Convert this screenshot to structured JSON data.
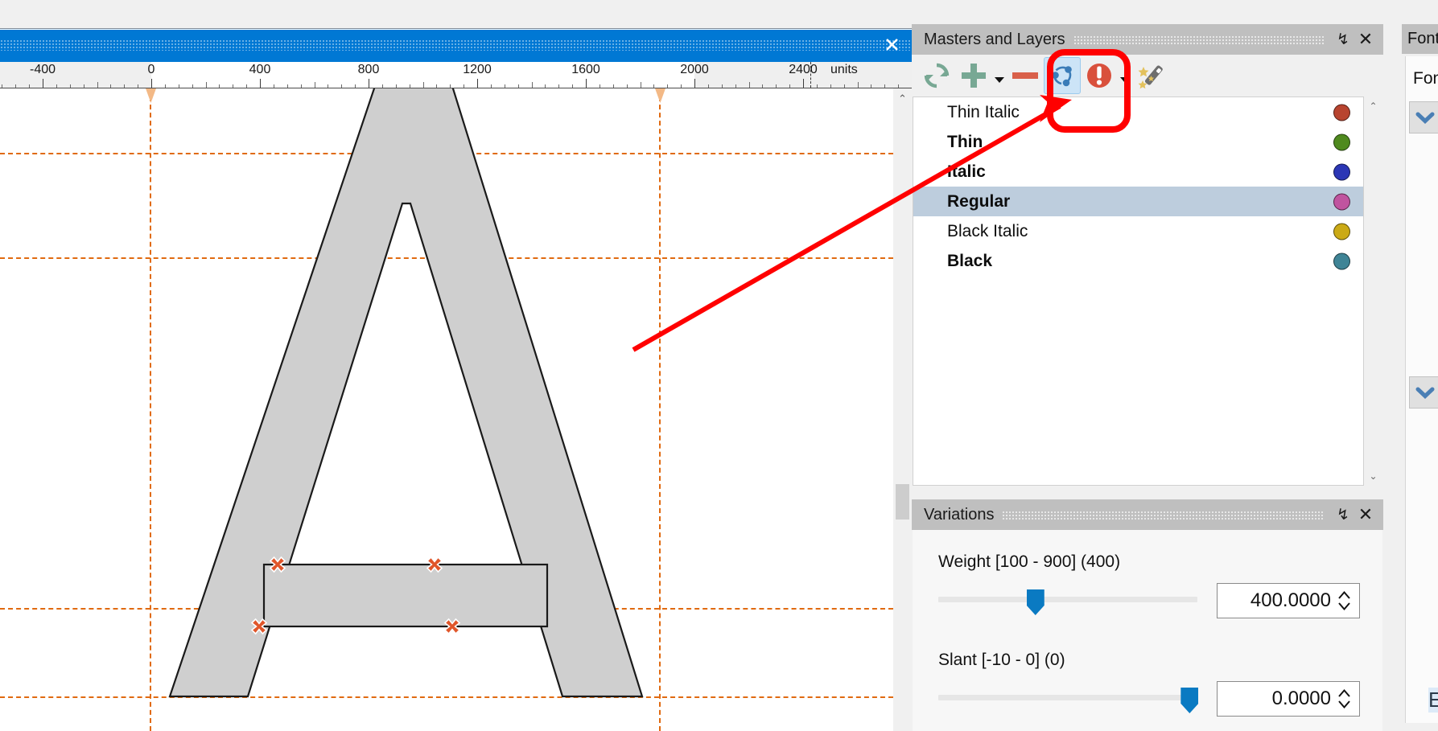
{
  "window": {
    "tab_close_label": "✕",
    "accent_blue": "#0078d4"
  },
  "ruler": {
    "units_label": "units",
    "tick_labels": [
      "-400",
      "0",
      "400",
      "800",
      "1200",
      "1600",
      "2000",
      "2400"
    ],
    "tick_values": [
      -400,
      0,
      400,
      800,
      1200,
      1600,
      2000,
      2400
    ],
    "advance_start": 0,
    "advance_end": 2000
  },
  "canvas": {
    "glyph": "A",
    "fill_color": "#cfcfcf",
    "stroke_color": "#1a1a1a",
    "guide_color": "#e06a10",
    "node_marker_color": "#e0562a",
    "node_marker_glyph": "✕",
    "node_markers": 4,
    "scrollbar": {
      "up_chevron": "⌃"
    }
  },
  "masters_panel": {
    "title": "Masters and Layers",
    "pin_label": "↯",
    "close_label": "✕",
    "toolbar": [
      {
        "name": "refresh-icon",
        "label": "Refresh",
        "color": "#78a894",
        "selected": false
      },
      {
        "name": "add-icon",
        "label": "Add Master",
        "color": "#78a894",
        "selected": false
      },
      {
        "name": "remove-icon",
        "label": "Remove Master",
        "color": "#d9604a",
        "selected": false
      },
      {
        "name": "link-nodes-icon",
        "label": "Match Nodes",
        "color": "#3a7cb8",
        "selected": true
      },
      {
        "name": "warning-icon",
        "label": "Errors",
        "color": "#d9503c",
        "selected": false
      },
      {
        "name": "magic-wand-icon",
        "label": "Auto Fix",
        "color": "#6e6e6e",
        "selected": false
      }
    ],
    "masters": [
      {
        "label": "Thin Italic",
        "color": "#b8442f",
        "bold": false,
        "selected": false
      },
      {
        "label": "Thin",
        "color": "#4f8a1e",
        "bold": true,
        "selected": false
      },
      {
        "label": "Italic",
        "color": "#2b36b5",
        "bold": true,
        "selected": false
      },
      {
        "label": "Regular",
        "color": "#c0549f",
        "bold": true,
        "selected": true
      },
      {
        "label": "Black Italic",
        "color": "#cbaa16",
        "bold": false,
        "selected": false
      },
      {
        "label": "Black",
        "color": "#3f8496",
        "bold": true,
        "selected": false
      }
    ],
    "list_scroll_up": "⌃",
    "list_scroll_down": "⌄"
  },
  "variations_panel": {
    "title": "Variations",
    "pin_label": "↯",
    "close_label": "✕",
    "axes": [
      {
        "label": "Weight [100 - 900] (400)",
        "name": "Weight",
        "min": 100,
        "max": 900,
        "default": 400,
        "value": "400.0000",
        "knob_pct": 37.5
      },
      {
        "label": "Slant [-10 - 0] (0)",
        "name": "Slant",
        "min": -10,
        "max": 0,
        "default": 0,
        "value": "0.0000",
        "knob_pct": 97
      }
    ]
  },
  "font_panel": {
    "title": "Font",
    "subtitle": "Font",
    "chevron": "❯",
    "bottom_char": "E"
  }
}
